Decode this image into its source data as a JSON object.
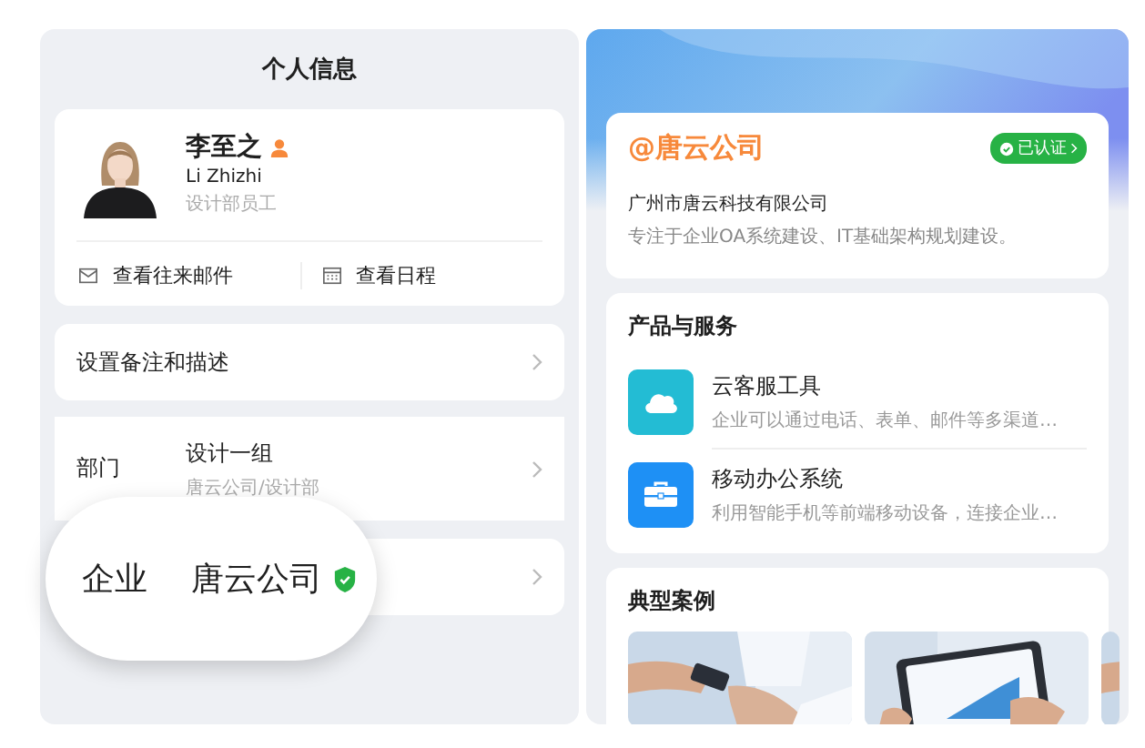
{
  "left_panel": {
    "title": "个人信息",
    "profile": {
      "name": "李至之",
      "name_en": "Li Zhizhi",
      "position": "设计部员工",
      "is_admin": true,
      "actions": [
        {
          "kind": "mail",
          "label": "查看往来邮件"
        },
        {
          "kind": "calendar",
          "label": "查看日程"
        }
      ]
    },
    "remark_row": {
      "label": "设置备注和描述"
    },
    "department_row": {
      "label": "部门",
      "value": "设计一组",
      "path": "唐云公司/设计部"
    },
    "company_row": {
      "label": "企业",
      "value": "唐云公司",
      "verified": true
    }
  },
  "right_panel": {
    "company_card": {
      "name": "@唐云公司",
      "badge": "已认证",
      "full_name": "广州市唐云科技有限公司",
      "description": "专注于企业OA系统建设、IT基础架构规划建设。"
    },
    "products": {
      "title": "产品与服务",
      "items": [
        {
          "kind": "cloud",
          "color": "#23bcd4",
          "name": "云客服工具",
          "description": "企业可以通过电话、表单、邮件等多渠道…"
        },
        {
          "kind": "briefcase",
          "color": "#1e90f5",
          "name": "移动办公系统",
          "description": "利用智能手机等前端移动设备，连接企业…"
        }
      ]
    },
    "cases": {
      "title": "典型案例"
    }
  }
}
